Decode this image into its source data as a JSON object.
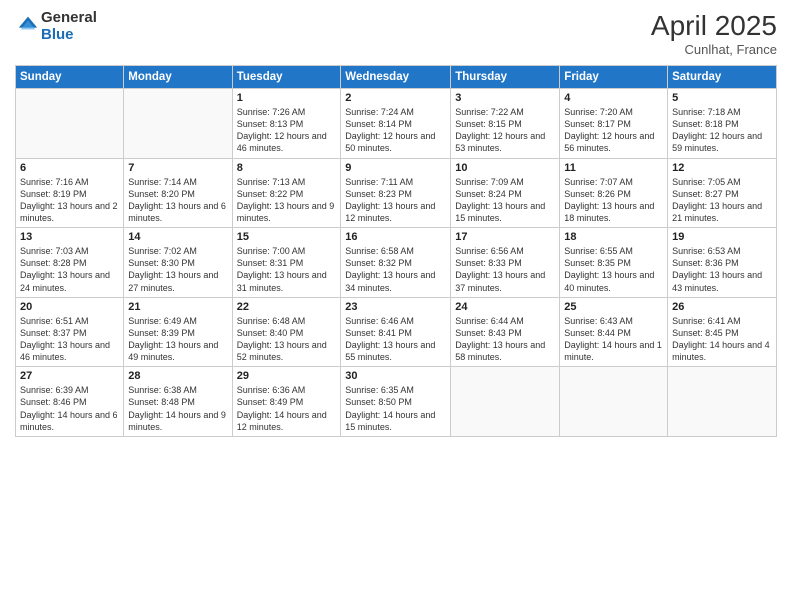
{
  "header": {
    "logo_line1": "General",
    "logo_line2": "Blue",
    "month": "April 2025",
    "location": "Cunlhat, France"
  },
  "weekdays": [
    "Sunday",
    "Monday",
    "Tuesday",
    "Wednesday",
    "Thursday",
    "Friday",
    "Saturday"
  ],
  "weeks": [
    [
      {
        "day": "",
        "info": ""
      },
      {
        "day": "",
        "info": ""
      },
      {
        "day": "1",
        "info": "Sunrise: 7:26 AM\nSunset: 8:13 PM\nDaylight: 12 hours and 46 minutes."
      },
      {
        "day": "2",
        "info": "Sunrise: 7:24 AM\nSunset: 8:14 PM\nDaylight: 12 hours and 50 minutes."
      },
      {
        "day": "3",
        "info": "Sunrise: 7:22 AM\nSunset: 8:15 PM\nDaylight: 12 hours and 53 minutes."
      },
      {
        "day": "4",
        "info": "Sunrise: 7:20 AM\nSunset: 8:17 PM\nDaylight: 12 hours and 56 minutes."
      },
      {
        "day": "5",
        "info": "Sunrise: 7:18 AM\nSunset: 8:18 PM\nDaylight: 12 hours and 59 minutes."
      }
    ],
    [
      {
        "day": "6",
        "info": "Sunrise: 7:16 AM\nSunset: 8:19 PM\nDaylight: 13 hours and 2 minutes."
      },
      {
        "day": "7",
        "info": "Sunrise: 7:14 AM\nSunset: 8:20 PM\nDaylight: 13 hours and 6 minutes."
      },
      {
        "day": "8",
        "info": "Sunrise: 7:13 AM\nSunset: 8:22 PM\nDaylight: 13 hours and 9 minutes."
      },
      {
        "day": "9",
        "info": "Sunrise: 7:11 AM\nSunset: 8:23 PM\nDaylight: 13 hours and 12 minutes."
      },
      {
        "day": "10",
        "info": "Sunrise: 7:09 AM\nSunset: 8:24 PM\nDaylight: 13 hours and 15 minutes."
      },
      {
        "day": "11",
        "info": "Sunrise: 7:07 AM\nSunset: 8:26 PM\nDaylight: 13 hours and 18 minutes."
      },
      {
        "day": "12",
        "info": "Sunrise: 7:05 AM\nSunset: 8:27 PM\nDaylight: 13 hours and 21 minutes."
      }
    ],
    [
      {
        "day": "13",
        "info": "Sunrise: 7:03 AM\nSunset: 8:28 PM\nDaylight: 13 hours and 24 minutes."
      },
      {
        "day": "14",
        "info": "Sunrise: 7:02 AM\nSunset: 8:30 PM\nDaylight: 13 hours and 27 minutes."
      },
      {
        "day": "15",
        "info": "Sunrise: 7:00 AM\nSunset: 8:31 PM\nDaylight: 13 hours and 31 minutes."
      },
      {
        "day": "16",
        "info": "Sunrise: 6:58 AM\nSunset: 8:32 PM\nDaylight: 13 hours and 34 minutes."
      },
      {
        "day": "17",
        "info": "Sunrise: 6:56 AM\nSunset: 8:33 PM\nDaylight: 13 hours and 37 minutes."
      },
      {
        "day": "18",
        "info": "Sunrise: 6:55 AM\nSunset: 8:35 PM\nDaylight: 13 hours and 40 minutes."
      },
      {
        "day": "19",
        "info": "Sunrise: 6:53 AM\nSunset: 8:36 PM\nDaylight: 13 hours and 43 minutes."
      }
    ],
    [
      {
        "day": "20",
        "info": "Sunrise: 6:51 AM\nSunset: 8:37 PM\nDaylight: 13 hours and 46 minutes."
      },
      {
        "day": "21",
        "info": "Sunrise: 6:49 AM\nSunset: 8:39 PM\nDaylight: 13 hours and 49 minutes."
      },
      {
        "day": "22",
        "info": "Sunrise: 6:48 AM\nSunset: 8:40 PM\nDaylight: 13 hours and 52 minutes."
      },
      {
        "day": "23",
        "info": "Sunrise: 6:46 AM\nSunset: 8:41 PM\nDaylight: 13 hours and 55 minutes."
      },
      {
        "day": "24",
        "info": "Sunrise: 6:44 AM\nSunset: 8:43 PM\nDaylight: 13 hours and 58 minutes."
      },
      {
        "day": "25",
        "info": "Sunrise: 6:43 AM\nSunset: 8:44 PM\nDaylight: 14 hours and 1 minute."
      },
      {
        "day": "26",
        "info": "Sunrise: 6:41 AM\nSunset: 8:45 PM\nDaylight: 14 hours and 4 minutes."
      }
    ],
    [
      {
        "day": "27",
        "info": "Sunrise: 6:39 AM\nSunset: 8:46 PM\nDaylight: 14 hours and 6 minutes."
      },
      {
        "day": "28",
        "info": "Sunrise: 6:38 AM\nSunset: 8:48 PM\nDaylight: 14 hours and 9 minutes."
      },
      {
        "day": "29",
        "info": "Sunrise: 6:36 AM\nSunset: 8:49 PM\nDaylight: 14 hours and 12 minutes."
      },
      {
        "day": "30",
        "info": "Sunrise: 6:35 AM\nSunset: 8:50 PM\nDaylight: 14 hours and 15 minutes."
      },
      {
        "day": "",
        "info": ""
      },
      {
        "day": "",
        "info": ""
      },
      {
        "day": "",
        "info": ""
      }
    ]
  ]
}
